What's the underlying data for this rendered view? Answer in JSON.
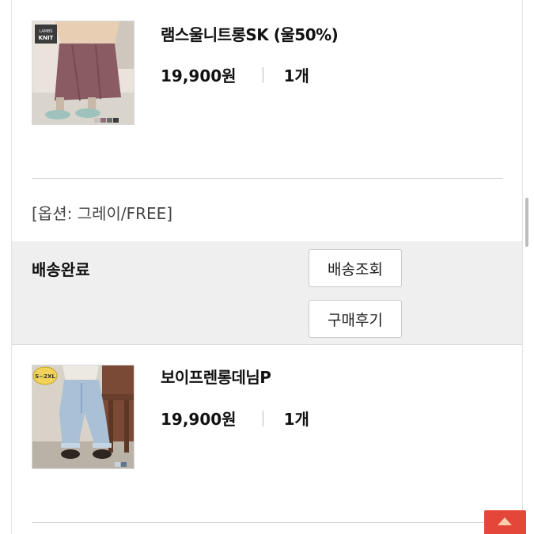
{
  "orders": [
    {
      "product_name": "램스울니트롱SK (울50%)",
      "price": "19,900원",
      "quantity": "1개",
      "thumb_badge_line1": "LAMBS",
      "thumb_badge_line2": "KNIT"
    },
    {
      "product_name": "보이프렌롱데님P",
      "price": "19,900원",
      "quantity": "1개",
      "thumb_badge_line1": "S~2XL"
    }
  ],
  "option_text": "[옵션: 그레이/FREE]",
  "status": {
    "label": "배송완료",
    "track_button": "배송조회",
    "review_button": "구매후기"
  },
  "colors": {
    "top_button": "#e4473a",
    "panel_bg": "#efefef"
  },
  "icons": {
    "top_button": "arrow-up-icon"
  }
}
